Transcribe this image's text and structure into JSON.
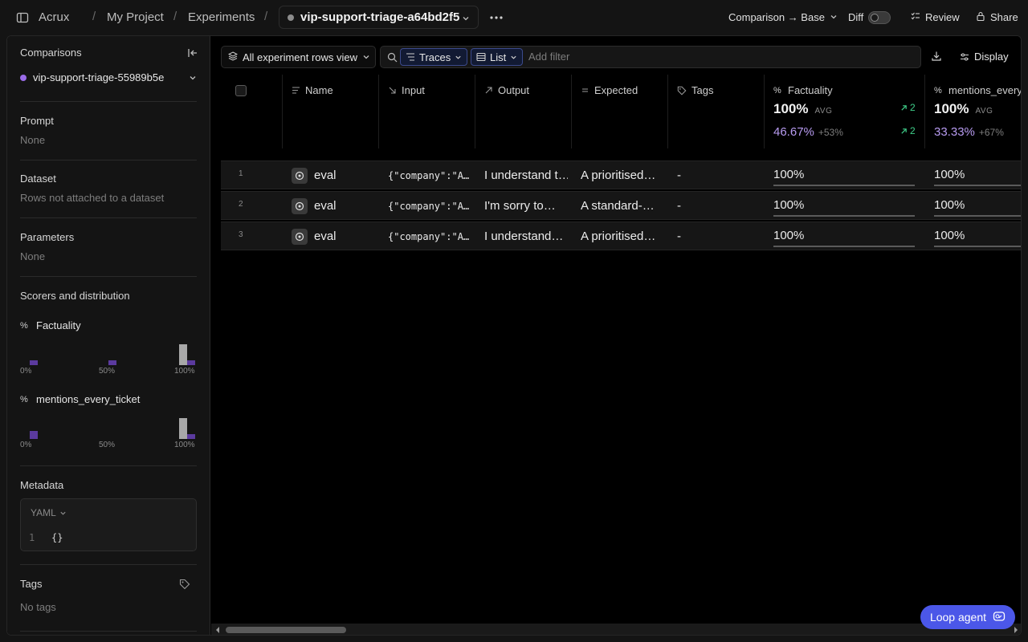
{
  "topbar": {
    "app_name": "Acrux",
    "breadcrumbs": [
      "My Project",
      "Experiments"
    ],
    "separator": "/",
    "experiment": "vip-support-triage-a64bd2f5",
    "comparison_label": "Comparison → Base",
    "diff_label": "Diff",
    "diff_enabled": false,
    "review_label": "Review",
    "share_label": "Share"
  },
  "sidebar": {
    "comparisons_title": "Comparisons",
    "comparison_item": "vip-support-triage-55989b5e",
    "comparison_color": "#9a6ce8",
    "prompt_title": "Prompt",
    "prompt_value": "None",
    "dataset_title": "Dataset",
    "dataset_value": "Rows not attached to a dataset",
    "parameters_title": "Parameters",
    "parameters_value": "None",
    "scorers_title": "Scorers and distribution",
    "scorers": [
      {
        "name": "Factuality",
        "axis": [
          "0%",
          "50%",
          "100%"
        ],
        "base_counts": [
          0,
          0,
          3
        ],
        "compare_counts": [
          1,
          1,
          1
        ]
      },
      {
        "name": "mentions_every_ticket",
        "axis": [
          "0%",
          "50%",
          "100%"
        ],
        "base_counts": [
          0,
          0,
          3
        ],
        "compare_counts": [
          2,
          0,
          1
        ]
      }
    ],
    "metadata_title": "Metadata",
    "metadata_format": "YAML",
    "metadata_line": "1",
    "metadata_code": "{}",
    "tags_title": "Tags",
    "tags_value": "No tags"
  },
  "toolbar": {
    "view_label": "All experiment rows view",
    "traces_label": "Traces",
    "list_label": "List",
    "filter_placeholder": "Add filter",
    "display_label": "Display"
  },
  "table": {
    "columns": [
      "Name",
      "Input",
      "Output",
      "Expected",
      "Tags",
      "Factuality",
      "mentions_every_"
    ],
    "factuality_summary": {
      "avg": "100%",
      "avg_label": "AVG",
      "compare": "46.67%",
      "delta": "+53%",
      "improved": "2",
      "improved_cmp": "2"
    },
    "mentions_summary": {
      "avg": "100%",
      "avg_label": "AVG",
      "compare": "33.33%",
      "delta": "+67%"
    },
    "rows": [
      {
        "num": "1",
        "name": "eval",
        "input": "{\"company\":\"A…",
        "output": "I understand t…",
        "expected": "A prioritised…",
        "tags": "-",
        "factuality": "100%",
        "factuality_value": 1.0,
        "mentions": "100%",
        "mentions_value": 1.0
      },
      {
        "num": "2",
        "name": "eval",
        "input": "{\"company\":\"A…",
        "output": "I'm sorry to…",
        "expected": "A standard-…",
        "tags": "-",
        "factuality": "100%",
        "factuality_value": 1.0,
        "mentions": "100%",
        "mentions_value": 1.0
      },
      {
        "num": "3",
        "name": "eval",
        "input": "{\"company\":\"A…",
        "output": "I understand…",
        "expected": "A prioritised…",
        "tags": "-",
        "factuality": "100%",
        "factuality_value": 1.0,
        "mentions": "100%",
        "mentions_value": 1.0
      }
    ]
  },
  "loop_agent_label": "Loop agent"
}
